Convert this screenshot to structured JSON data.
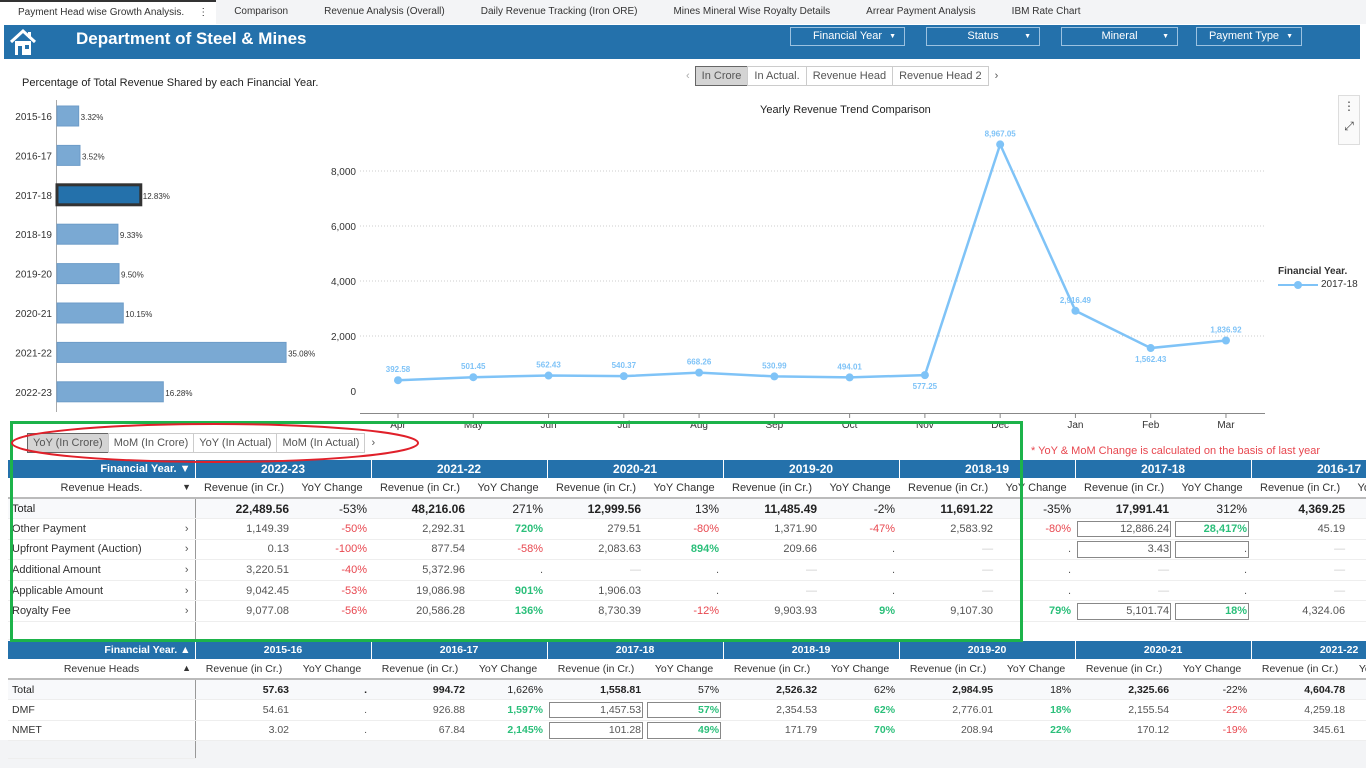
{
  "tabs": [
    "Payment Head wise Growth Analysis.",
    "Comparison",
    "Revenue Analysis (Overall)",
    "Daily Revenue Tracking (Iron ORE)",
    "Mines Mineral Wise Royalty Details",
    "Arrear Payment Analysis",
    "IBM Rate Chart"
  ],
  "tab_more": "⋮",
  "header": {
    "title": "Department of Steel & Mines",
    "icon": "home-icon"
  },
  "filters": [
    "Financial Year",
    "Status",
    "Mineral",
    "Payment Type"
  ],
  "filter_arrow": "▼",
  "bar_chart": {
    "title": "Percentage of Total Revenue Shared by each Financial Year.",
    "type": "bar",
    "categories": [
      "2015-16",
      "2016-17",
      "2017-18",
      "2018-19",
      "2019-20",
      "2020-21",
      "2021-22",
      "2022-23"
    ],
    "values": [
      3.32,
      3.52,
      12.83,
      9.33,
      9.5,
      10.15,
      35.08,
      16.28
    ],
    "labels": [
      "3.32%",
      "3.52%",
      "12.83%",
      "9.33%",
      "9.50%",
      "10.15%",
      "35.08%",
      "16.28%"
    ],
    "selected": "2017-18",
    "color": "#7aa9d3"
  },
  "view_buttons": {
    "prev": "‹",
    "items": [
      "In Crore",
      "In Actual.",
      "Revenue Head",
      "Revenue Head 2"
    ],
    "active": 0,
    "next": "›"
  },
  "chart_data": {
    "type": "line",
    "title": "Yearly Revenue Trend Comparison",
    "categories": [
      "Apr",
      "May",
      "Jun",
      "Jul",
      "Aug",
      "Sep",
      "Oct",
      "Nov",
      "Dec",
      "Jan",
      "Feb",
      "Mar"
    ],
    "series": [
      {
        "name": "2017-18",
        "values": [
          392.58,
          501.45,
          562.43,
          540.37,
          668.26,
          530.99,
          494.01,
          577.25,
          8967.05,
          2916.49,
          1562.43,
          1836.92
        ],
        "labels": [
          "392.58",
          "501.45",
          "562.43",
          "540.37",
          "668.26",
          "530.99",
          "494.01",
          "577.25",
          "8,967.05",
          "2,916.49",
          "1,562.43",
          "1,836.92"
        ]
      }
    ],
    "yticks": [
      "0",
      "2,000",
      "4,000",
      "6,000",
      "8,000"
    ],
    "ytick_values": [
      0,
      2000,
      4000,
      6000,
      8000
    ],
    "ylim": [
      0,
      8000
    ],
    "grid": true,
    "legend": {
      "title": "Financial Year.",
      "placement": "right"
    },
    "color": "#7fc3f7"
  },
  "side_buttons": {
    "menu": "⋮",
    "expand": "⤢"
  },
  "change_buttons": {
    "items": [
      "YoY (In Crore)",
      "MoM (In Crore)",
      "YoY (In Actual)",
      "MoM (In Actual)"
    ],
    "active": 0,
    "next": "›"
  },
  "note": "* YoY & MoM Change is calculated on the basis of last year",
  "top_table": {
    "corner": "Financial Year. ▼",
    "row_header": "Revenue Heads.",
    "row_arrow": "▼",
    "years": [
      "2022-23",
      "2021-22",
      "2020-21",
      "2019-20",
      "2018-19",
      "2017-18",
      "2016-17"
    ],
    "sub": [
      "Revenue (in Cr.)",
      "YoY Change"
    ],
    "rows": [
      {
        "label": "Total",
        "cells": [
          [
            "22,489.56",
            "-53%"
          ],
          [
            "48,216.06",
            "271%"
          ],
          [
            "12,999.56",
            "13%"
          ],
          [
            "11,485.49",
            "-2%"
          ],
          [
            "11,691.22",
            "-35%"
          ],
          [
            "17,991.41",
            "312%"
          ],
          [
            "4,369.25",
            ""
          ]
        ]
      },
      {
        "label": "Other Payment",
        "cells": [
          [
            "1,149.39",
            "-50%"
          ],
          [
            "2,292.31",
            "720%"
          ],
          [
            "279.51",
            "-80%"
          ],
          [
            "1,371.90",
            "-47%"
          ],
          [
            "2,583.92",
            "-80%"
          ],
          [
            "12,886.24",
            "28,417%"
          ],
          [
            "45.19",
            ""
          ]
        ]
      },
      {
        "label": "Upfront Payment (Auction)",
        "cells": [
          [
            "0.13",
            "-100%"
          ],
          [
            "877.54",
            "-58%"
          ],
          [
            "2,083.63",
            "894%"
          ],
          [
            "209.66",
            "."
          ],
          [
            "—",
            "."
          ],
          [
            "3.43",
            "."
          ],
          [
            "—",
            ""
          ]
        ]
      },
      {
        "label": "Additional Amount",
        "cells": [
          [
            "3,220.51",
            "-40%"
          ],
          [
            "5,372.96",
            "."
          ],
          [
            "—",
            "."
          ],
          [
            "—",
            "."
          ],
          [
            "—",
            "."
          ],
          [
            "—",
            "."
          ],
          [
            "—",
            ""
          ]
        ]
      },
      {
        "label": "Applicable Amount",
        "cells": [
          [
            "9,042.45",
            "-53%"
          ],
          [
            "19,086.98",
            "901%"
          ],
          [
            "1,906.03",
            "."
          ],
          [
            "—",
            "."
          ],
          [
            "—",
            "."
          ],
          [
            "—",
            "."
          ],
          [
            "—",
            ""
          ]
        ]
      },
      {
        "label": "Royalty Fee",
        "cells": [
          [
            "9,077.08",
            "-56%"
          ],
          [
            "20,586.28",
            "136%"
          ],
          [
            "8,730.39",
            "-12%"
          ],
          [
            "9,903.93",
            "9%"
          ],
          [
            "9,107.30",
            "79%"
          ],
          [
            "5,101.74",
            "18%"
          ],
          [
            "4,324.06",
            ""
          ]
        ]
      }
    ],
    "chevron": "›"
  },
  "bottom_table": {
    "corner": "Financial Year. ▲",
    "row_header": "Revenue Heads",
    "row_arrow": "▲",
    "years": [
      "2015-16",
      "2016-17",
      "2017-18",
      "2018-19",
      "2019-20",
      "2020-21",
      "2021-22"
    ],
    "sub": [
      "Revenue (in Cr.)",
      "YoY Change"
    ],
    "rows": [
      {
        "label": "Total",
        "cells": [
          [
            "57.63",
            "."
          ],
          [
            "994.72",
            "1,626%"
          ],
          [
            "1,558.81",
            "57%"
          ],
          [
            "2,526.32",
            "62%"
          ],
          [
            "2,984.95",
            "18%"
          ],
          [
            "2,325.66",
            "-22%"
          ],
          [
            "4,604.78",
            ""
          ]
        ]
      },
      {
        "label": "DMF",
        "cells": [
          [
            "54.61",
            "."
          ],
          [
            "926.88",
            "1,597%"
          ],
          [
            "1,457.53",
            "57%"
          ],
          [
            "2,354.53",
            "62%"
          ],
          [
            "2,776.01",
            "18%"
          ],
          [
            "2,155.54",
            "-22%"
          ],
          [
            "4,259.18",
            ""
          ]
        ]
      },
      {
        "label": "NMET",
        "cells": [
          [
            "3.02",
            "."
          ],
          [
            "67.84",
            "2,145%"
          ],
          [
            "101.28",
            "49%"
          ],
          [
            "171.79",
            "70%"
          ],
          [
            "208.94",
            "22%"
          ],
          [
            "170.12",
            "-19%"
          ],
          [
            "345.61",
            ""
          ]
        ]
      }
    ]
  },
  "colors": {
    "header": "#2471ab",
    "negative": "#e8474f",
    "positive": "#2bbf7a",
    "annotation_green": "#1db34a",
    "annotation_red": "#e0202a"
  }
}
